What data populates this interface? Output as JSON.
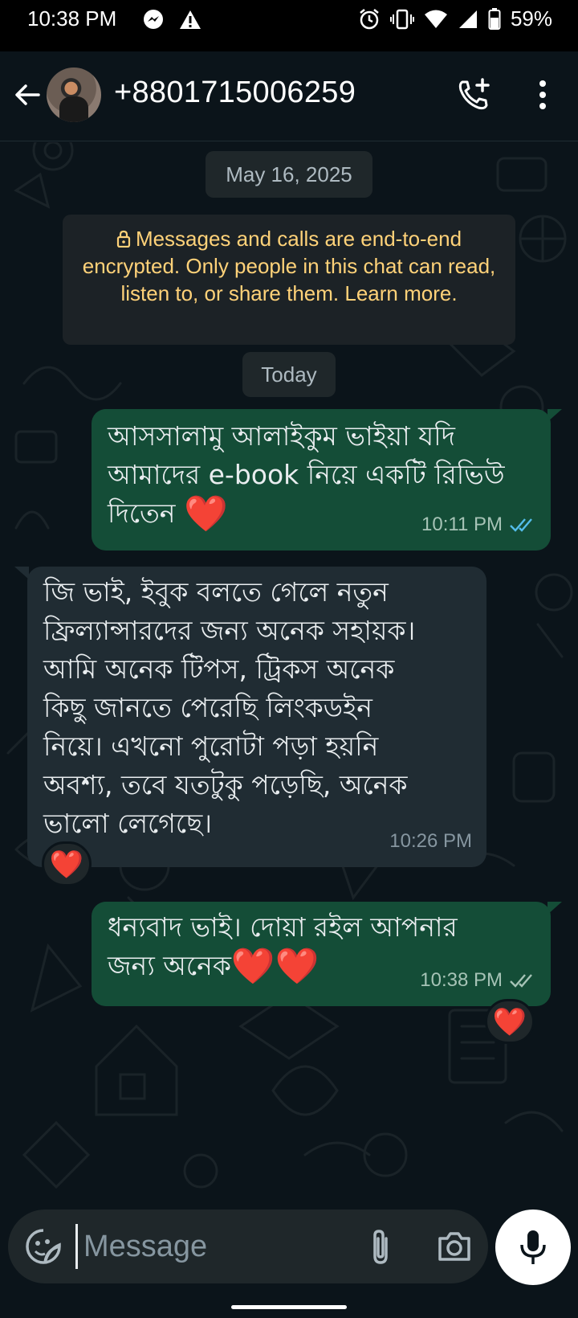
{
  "status_bar": {
    "time": "10:38 PM",
    "battery_text": "59%",
    "icons": [
      "messenger-icon",
      "warning-icon",
      "alarm-icon",
      "vibrate-icon",
      "wifi-icon",
      "signal-icon",
      "battery-icon"
    ]
  },
  "header": {
    "contact": "+8801715006259",
    "icons": [
      "back-arrow-icon",
      "add-call-icon",
      "more-vert-icon"
    ]
  },
  "chat": {
    "date_chip": "May 16, 2025",
    "encryption_notice": "Messages and calls are end-to-end encrypted. Only people in this chat can read, listen to, or share them. Learn more.",
    "today_chip": "Today",
    "messages": [
      {
        "direction": "outgoing",
        "lines": [
          "আসসালামু আলাইকুম ভাইয়া যদি",
          "আমাদের e-book নিয়ে একটি রিভিউ",
          "দিতেন"
        ],
        "emoji": "❤️",
        "time": "10:11 PM",
        "status": "read"
      },
      {
        "direction": "incoming",
        "lines": [
          "জি ভাই, ইবুক বলতে গেলে নতুন",
          "ফ্রিল্যান্সারদের জন্য অনেক সহায়ক।",
          "আমি অনেক টিপস, ট্রিকস অনেক",
          "কিছু জানতে পেরেছি লিংকডইন",
          "নিয়ে। এখনো পুরোটা পড়া হয়নি",
          "অবশ্য, তবে যতটুকু পড়েছি, অনেক",
          "ভালো লেগেছে।"
        ],
        "time": "10:26 PM",
        "reaction": "❤️"
      },
      {
        "direction": "outgoing",
        "lines": [
          "ধন্যবাদ ভাই। দোয়া রইল আপনার",
          "জন্য অনেক"
        ],
        "emoji": "❤️❤️",
        "time": "10:38 PM",
        "status": "delivered",
        "reaction": "❤️"
      }
    ]
  },
  "composer": {
    "placeholder": "Message",
    "icons": [
      "sticker-icon",
      "paperclip-icon",
      "camera-icon",
      "microphone-icon"
    ]
  },
  "colors": {
    "background": "#0b141a",
    "outgoing_bubble": "#144d37",
    "incoming_bubble": "#202c33",
    "notice_text": "#ffd279",
    "read_tick": "#53bdeb",
    "heart": "#ff1f3d"
  }
}
